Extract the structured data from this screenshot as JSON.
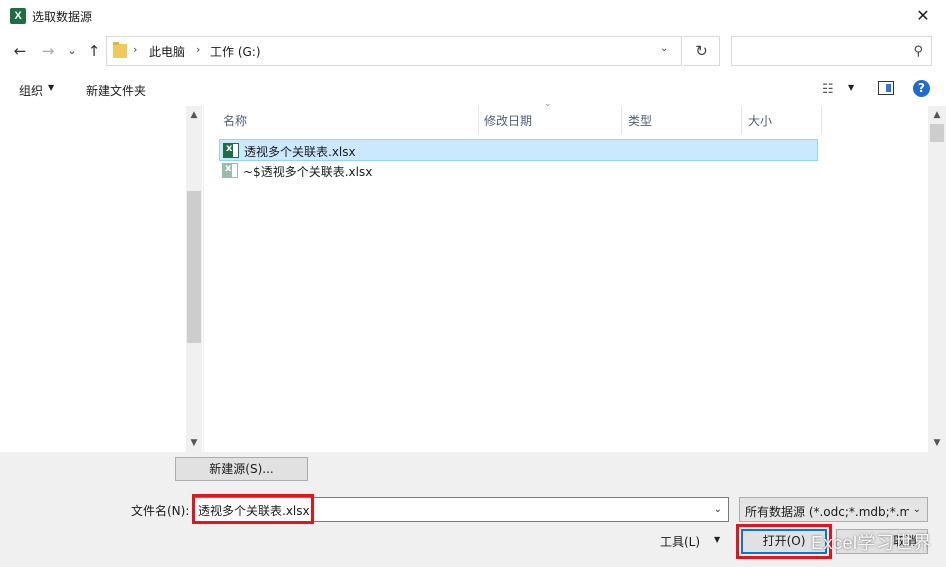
{
  "window": {
    "title": "选取数据源",
    "app_icon": "excel-icon",
    "close_glyph": "✕"
  },
  "address": {
    "back_icon": "←",
    "forward_icon": "→",
    "recent_icon": "⌄",
    "up_icon": "↑",
    "separator": "›",
    "crumbs": [
      "此电脑",
      "工作 (G:)"
    ],
    "refresh_icon": "↻",
    "search_placeholder": "",
    "search_icon": "⚲"
  },
  "toolbar": {
    "organize_label": "组织",
    "new_folder_label": "新建文件夹",
    "help_label": "?",
    "dropdown_glyph": "▼"
  },
  "file_list": {
    "columns": [
      "名称",
      "修改日期",
      "类型",
      "大小"
    ],
    "sort_glyph": "⌄",
    "files": [
      {
        "name": "透视多个关联表.xlsx",
        "selected": true
      },
      {
        "name": "~$透视多个关联表.xlsx",
        "selected": false
      }
    ]
  },
  "scroll": {
    "up_glyph": "▲",
    "down_glyph": "▼"
  },
  "bottom": {
    "new_source_label": "新建源(S)...",
    "filename_label": "文件名(N):",
    "filename_value": "透视多个关联表.xlsx",
    "filter_value": "所有数据源 (*.odc;*.mdb;*.md",
    "tools_label": "工具(L)",
    "open_label": "打开(O)",
    "cancel_label": "取消",
    "watermark": "Excel学习世界",
    "dropdown_glyph": "⌄"
  },
  "colors": {
    "highlight_box": "#e5141b",
    "selected_row": "#cce8ff",
    "excel_green": "#1d6f42",
    "accent": "#0078d7"
  }
}
